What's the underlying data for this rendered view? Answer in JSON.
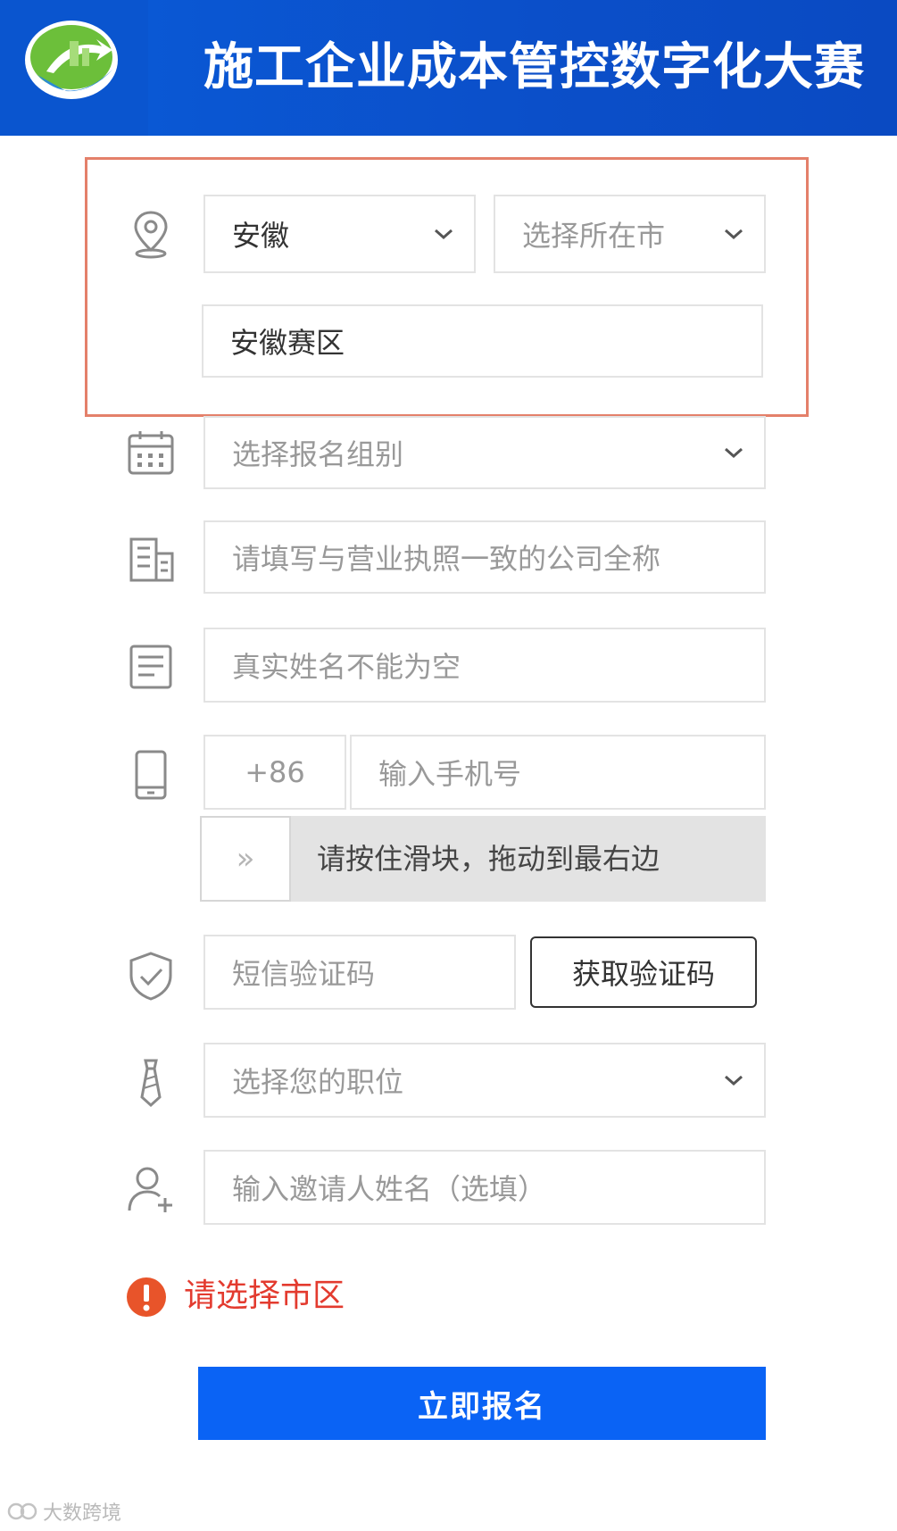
{
  "header": {
    "title": "施工企业成本管控数字化大赛"
  },
  "region": {
    "province_value": "安徽",
    "city_placeholder": "选择所在市",
    "division_value": "安徽赛区"
  },
  "form": {
    "group_placeholder": "选择报名组别",
    "company_placeholder": "请填写与营业执照一致的公司全称",
    "name_placeholder": "真实姓名不能为空",
    "phone_prefix": "+86",
    "phone_placeholder": "输入手机号",
    "slider_arrow": "»",
    "slider_text": "请按住滑块，拖动到最右边",
    "sms_placeholder": "短信验证码",
    "sms_button": "获取验证码",
    "position_placeholder": "选择您的职位",
    "inviter_placeholder": "输入邀请人姓名（选填）"
  },
  "error": {
    "message": "请选择市区"
  },
  "submit_label": "立即报名",
  "watermark": "大数跨境",
  "colors": {
    "header": "#0a55cf",
    "accent": "#0a63f5",
    "error": "#e33b2f",
    "highlight": "#e4806a"
  }
}
